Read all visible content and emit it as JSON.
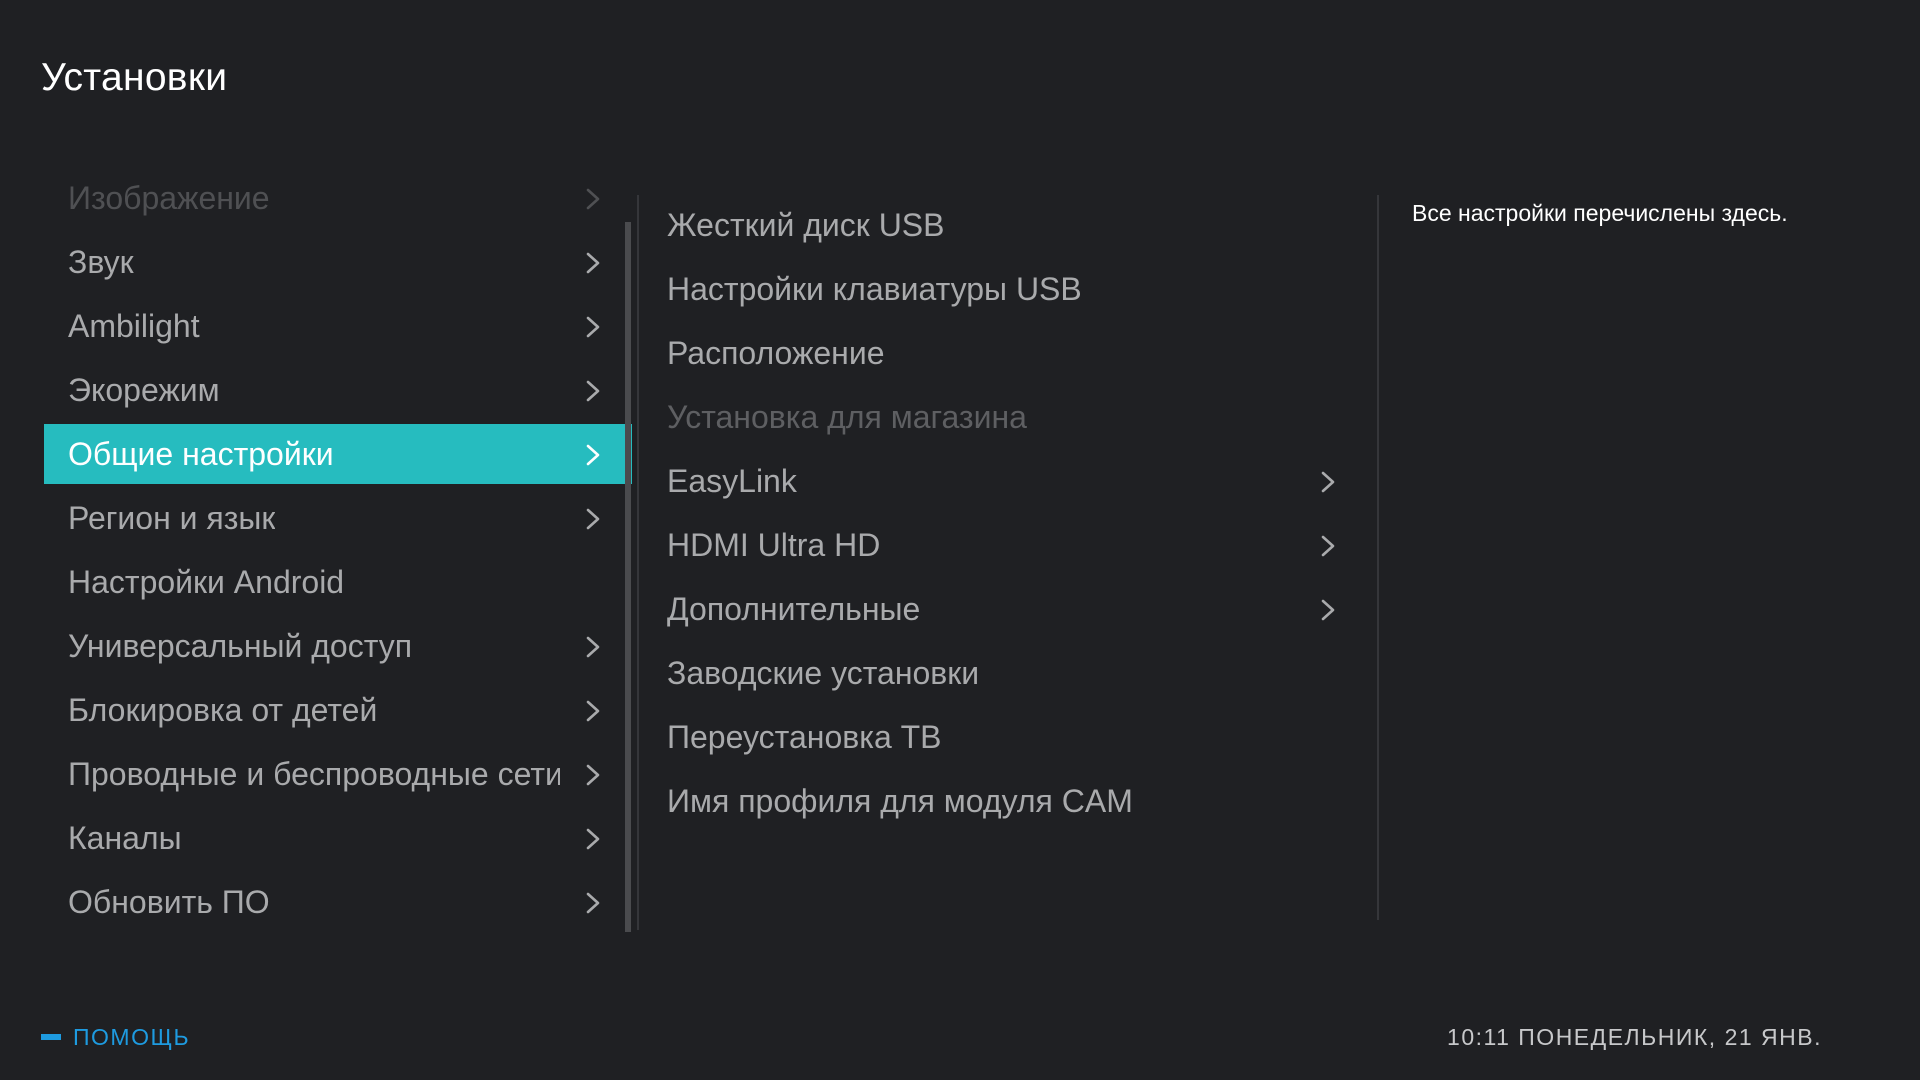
{
  "page": {
    "title": "Установки"
  },
  "left_menu": {
    "items": [
      {
        "label": "Изображение",
        "has_submenu": true,
        "state": "faded"
      },
      {
        "label": "Звук",
        "has_submenu": true,
        "state": "normal"
      },
      {
        "label": "Ambilight",
        "has_submenu": true,
        "state": "normal"
      },
      {
        "label": "Экорежим",
        "has_submenu": true,
        "state": "normal"
      },
      {
        "label": "Общие настройки",
        "has_submenu": true,
        "state": "selected"
      },
      {
        "label": "Регион и язык",
        "has_submenu": true,
        "state": "normal"
      },
      {
        "label": "Настройки Android",
        "has_submenu": false,
        "state": "normal"
      },
      {
        "label": "Универсальный доступ",
        "has_submenu": true,
        "state": "normal"
      },
      {
        "label": "Блокировка от детей",
        "has_submenu": true,
        "state": "normal"
      },
      {
        "label": "Проводные и беспроводные сети",
        "has_submenu": true,
        "state": "normal"
      },
      {
        "label": "Каналы",
        "has_submenu": true,
        "state": "normal"
      },
      {
        "label": "Обновить ПО",
        "has_submenu": true,
        "state": "normal"
      }
    ]
  },
  "sub_menu": {
    "items": [
      {
        "label": "Жесткий диск USB",
        "has_submenu": false,
        "enabled": true
      },
      {
        "label": "Настройки клавиатуры USB",
        "has_submenu": false,
        "enabled": true
      },
      {
        "label": "Расположение",
        "has_submenu": false,
        "enabled": true
      },
      {
        "label": "Установка для магазина",
        "has_submenu": false,
        "enabled": false
      },
      {
        "label": "EasyLink",
        "has_submenu": true,
        "enabled": true
      },
      {
        "label": "HDMI Ultra HD",
        "has_submenu": true,
        "enabled": true
      },
      {
        "label": "Дополнительные",
        "has_submenu": true,
        "enabled": true
      },
      {
        "label": "Заводские установки",
        "has_submenu": false,
        "enabled": true
      },
      {
        "label": "Переустановка ТВ",
        "has_submenu": false,
        "enabled": true
      },
      {
        "label": "Имя профиля для модуля CAM",
        "has_submenu": false,
        "enabled": true
      }
    ]
  },
  "description": {
    "text": "Все настройки перечислены здесь."
  },
  "footer": {
    "help_label": "ПОМОЩЬ",
    "clock": "10:11 ПОНЕДЕЛЬНИК, 21 ЯНВ."
  },
  "colors": {
    "background": "#1f2023",
    "accent": "#26bcbf",
    "help_blue": "#1e9be0",
    "text_normal": "#a9aaac",
    "text_disabled": "#5e5f62"
  },
  "icons": {
    "submenu_arrow": "chevron-right-icon"
  }
}
